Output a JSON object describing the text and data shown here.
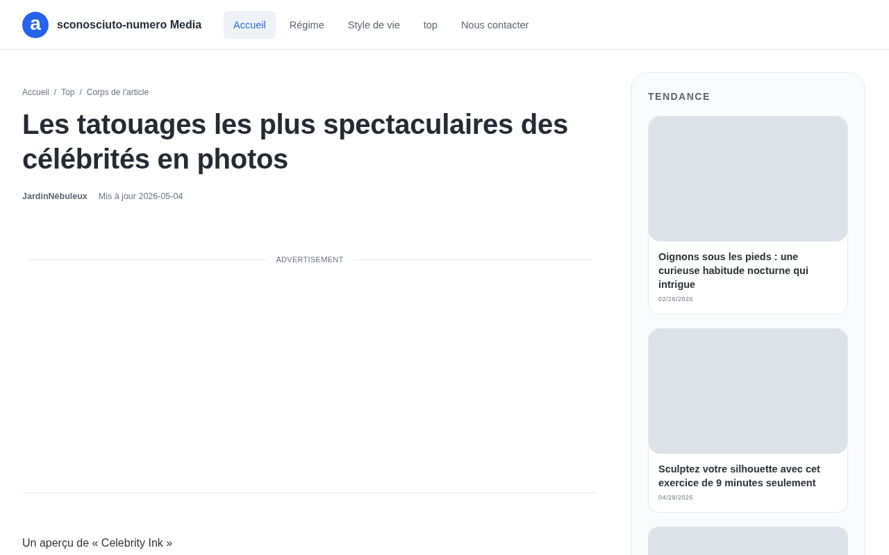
{
  "header": {
    "logo_letter": "a",
    "site_name": "sconosciuto-numero Media",
    "nav": [
      {
        "label": "Accueil",
        "selected": true
      },
      {
        "label": "Régime",
        "selected": false
      },
      {
        "label": "Style de vie",
        "selected": false
      },
      {
        "label": "top",
        "selected": false
      },
      {
        "label": "Nous contacter",
        "selected": false
      }
    ]
  },
  "breadcrumb": [
    "Accueil",
    "Top",
    "Corps de l’article"
  ],
  "breadcrumb_separator": "/",
  "article": {
    "title": "Les tatouages les plus spectaculaires des célébrités en photos",
    "author": "JardinNébuleux",
    "updated": "Mis à jour 2026-05-04",
    "ad_label": "ADVERTISEMENT",
    "body_start": "Un aperçu de « Celebrity Ink »"
  },
  "sidebar": {
    "heading": "TENDANCE",
    "cards": [
      {
        "title": "Oignons sous les pieds : une curieuse habitude nocturne qui intrigue",
        "date": "02/26/2026"
      },
      {
        "title": "Sculptez votre silhouette avec cet exercice de 9 minutes seulement",
        "date": "04/28/2026"
      },
      {
        "kind": "picture"
      }
    ]
  }
}
